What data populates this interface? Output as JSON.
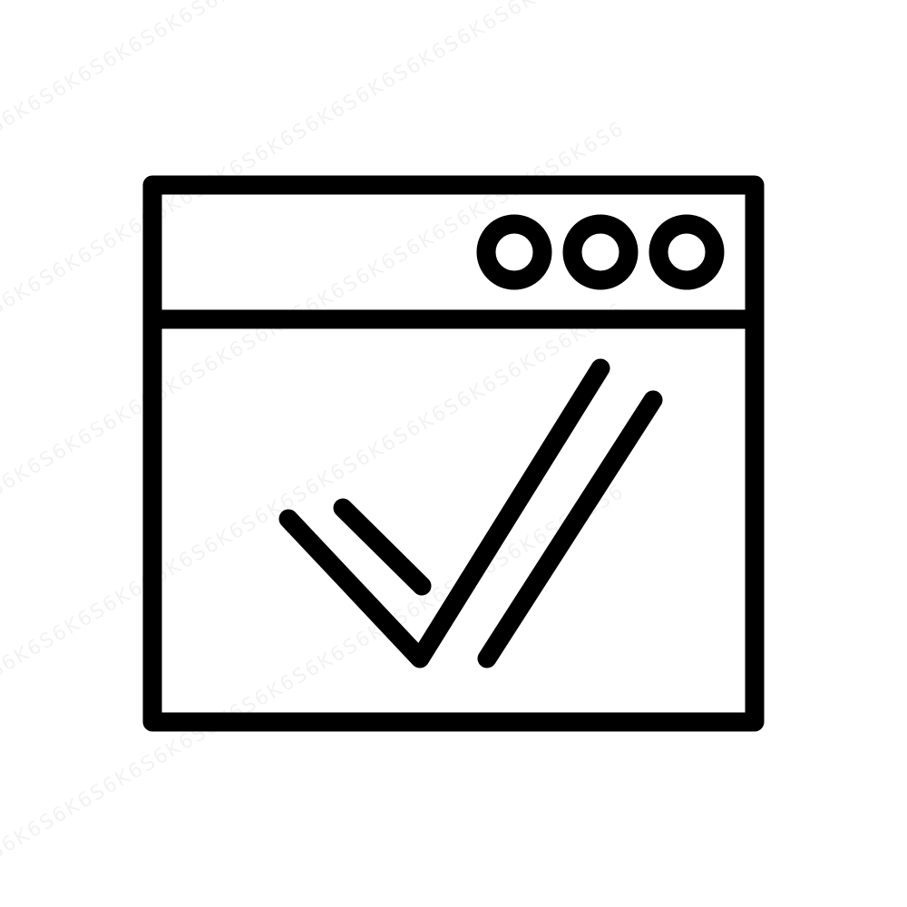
{
  "stock_id": "396341435",
  "watermark_text": "K6S6K6S6K6S6K6S6K6S6K6S6K6S6K6S6K6S6K6S6K6S6K6S6K6S6K6S6",
  "colors": {
    "stroke": "#000000",
    "background": "#ffffff"
  },
  "icons": {
    "main": "browser-window-check-icon"
  }
}
